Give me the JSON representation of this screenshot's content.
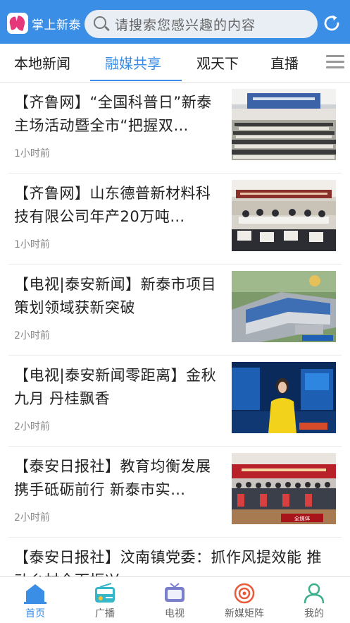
{
  "app": {
    "logo_text": "掌上新泰",
    "search_placeholder": "请搜索您感兴趣的内容"
  },
  "tabs": [
    {
      "label": "本地新闻",
      "active": false
    },
    {
      "label": "融媒共享",
      "active": true
    },
    {
      "label": "观天下",
      "active": false
    },
    {
      "label": "直播",
      "active": false
    }
  ],
  "feed": [
    {
      "title": "【齐鲁网】“全国科普日”新泰主场活动暨全市“把握双…",
      "time": "1小时前",
      "thumbnail": "conference-hall-event"
    },
    {
      "title": "【齐鲁网】山东德普新材料科技有限公司年产20万吨…",
      "time": "1小时前",
      "thumbnail": "meeting-room-signing"
    },
    {
      "title": "【电视|泰安新闻】新泰市项目策划领域获新突破",
      "time": "2小时前",
      "thumbnail": "aerial-factory"
    },
    {
      "title": "【电视|泰安新闻零距离】金秋九月 丹桂飘香",
      "time": "2小时前",
      "thumbnail": "tv-news-anchor"
    },
    {
      "title": "【泰安日报社】教育均衡发展 携手砥砺前行 新泰市实…",
      "time": "2小时前",
      "thumbnail": "group-photo-stage"
    },
    {
      "title": "【泰安日报社】汶南镇党委：抓作风提效能 推动乡村全面振兴",
      "time": "",
      "thumbnail": ""
    }
  ],
  "thumb_labels": {
    "media_watermark": "全媒体"
  },
  "bottom_nav": [
    {
      "label": "首页",
      "icon": "home-icon",
      "active": true
    },
    {
      "label": "广播",
      "icon": "radio-icon",
      "active": false
    },
    {
      "label": "电视",
      "icon": "tv-icon",
      "active": false
    },
    {
      "label": "新媒矩阵",
      "icon": "new-media-icon",
      "active": false
    },
    {
      "label": "我的",
      "icon": "profile-icon",
      "active": false
    }
  ],
  "colors": {
    "brand": "#3a8ee6",
    "logo_pink": "#e4387a",
    "active_tab": "#3a8ee6",
    "text": "#222222",
    "time_text": "#888888"
  }
}
